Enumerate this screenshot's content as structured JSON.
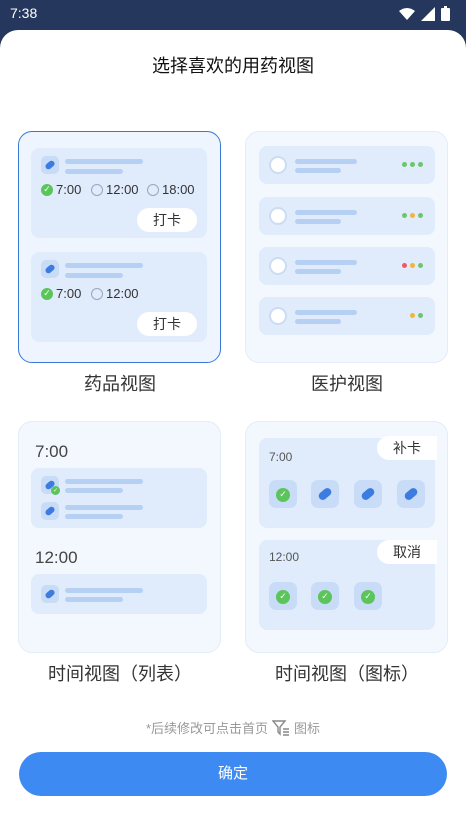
{
  "status_bar": {
    "time": "7:38"
  },
  "title": "选择喜欢的用药视图",
  "views": {
    "drug": {
      "label": "药品视图",
      "cards": [
        {
          "times": [
            "7:00",
            "12:00",
            "18:00"
          ],
          "button": "打卡"
        },
        {
          "times": [
            "7:00",
            "12:00"
          ],
          "button": "打卡"
        }
      ]
    },
    "care": {
      "label": "医护视图"
    },
    "timeline_list": {
      "label": "时间视图（列表）",
      "times": [
        "7:00",
        "12:00"
      ]
    },
    "timeline_icon": {
      "label": "时间视图（图标）",
      "blocks": [
        {
          "time": "7:00",
          "button": "补卡"
        },
        {
          "time": "12:00",
          "button": "取消"
        }
      ]
    }
  },
  "hint": {
    "before": "*后续修改可点击首页",
    "after": "图标"
  },
  "confirm_button": "确定",
  "colors": {
    "accent": "#3d8bf2",
    "selected_border": "#3a78d8",
    "check": "#5bc45b"
  }
}
